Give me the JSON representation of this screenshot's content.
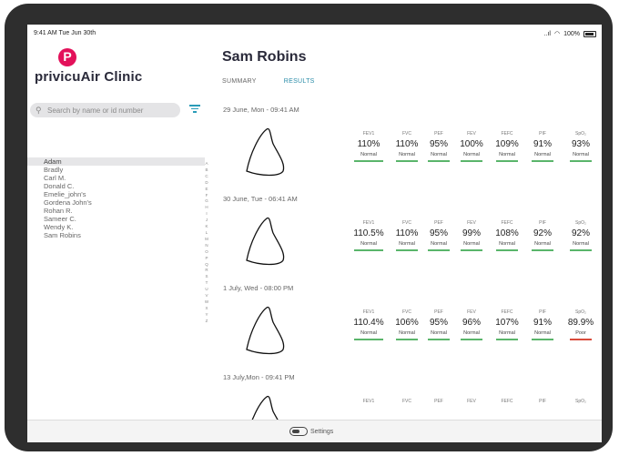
{
  "status": {
    "time": "9:41 AM  Tue Jun 30th",
    "signal": "..ıl",
    "battery": "100%"
  },
  "clinic": {
    "logo_letter": "P",
    "name": "privicuAir Clinic"
  },
  "search": {
    "placeholder": "Search by name or id number"
  },
  "patients": [
    {
      "name": "Adam",
      "selected": true
    },
    {
      "name": "Bradly",
      "selected": false
    },
    {
      "name": "Carl M.",
      "selected": false
    },
    {
      "name": "Donald C.",
      "selected": false
    },
    {
      "name": "Emelie_john's",
      "selected": false
    },
    {
      "name": "Gordena John's",
      "selected": false
    },
    {
      "name": "Rohan R.",
      "selected": false
    },
    {
      "name": "Sameer C.",
      "selected": false
    },
    {
      "name": "Wendy K.",
      "selected": false
    },
    {
      "name": "Sam Robins",
      "selected": false
    }
  ],
  "alphabet": [
    "A",
    "B",
    "C",
    "D",
    "E",
    "F",
    "G",
    "H",
    "I",
    "J",
    "K",
    "L",
    "M",
    "N",
    "O",
    "P",
    "Q",
    "R",
    "S",
    "T",
    "U",
    "V",
    "W",
    "X",
    "Y",
    "Z"
  ],
  "patient_name": "Sam Robins",
  "tabs": {
    "summary": "SUMMARY",
    "results": "RESULTS",
    "active": "results"
  },
  "metric_labels": [
    "FEV1",
    "FVC",
    "PEF",
    "FEV",
    "FEFC",
    "PIF",
    "SpO₂"
  ],
  "records": [
    {
      "date": "29 June, Mon - 09:41 AM",
      "values": [
        "110%",
        "110%",
        "95%",
        "100%",
        "109%",
        "91%",
        "93%"
      ],
      "statuses": [
        "Normal",
        "Normal",
        "Normal",
        "Normal",
        "Normal",
        "Normal",
        "Normal"
      ]
    },
    {
      "date": "30 June, Tue - 06:41 AM",
      "values": [
        "110.5%",
        "110%",
        "95%",
        "99%",
        "108%",
        "92%",
        "92%"
      ],
      "statuses": [
        "Normal",
        "Normal",
        "Normal",
        "Normal",
        "Normal",
        "Normal",
        "Normal"
      ]
    },
    {
      "date": "1 July, Wed - 08:00 PM",
      "values": [
        "110.4%",
        "106%",
        "95%",
        "96%",
        "107%",
        "91%",
        "89.9%"
      ],
      "statuses": [
        "Normal",
        "Normal",
        "Normal",
        "Normal",
        "Normal",
        "Normal",
        "Poor"
      ]
    },
    {
      "date": "13 July,Mon - 09:41 PM",
      "values": [
        "",
        "",
        "",
        "",
        "",
        "",
        ""
      ],
      "statuses": [
        "",
        "",
        "",
        "",
        "",
        "",
        ""
      ]
    }
  ],
  "colors": {
    "status_normal": "#5ab56b",
    "status_poor": "#d94b3b",
    "accent": "#2a8ca8",
    "brand": "#e3115a"
  },
  "settings": {
    "label": "Settings"
  }
}
